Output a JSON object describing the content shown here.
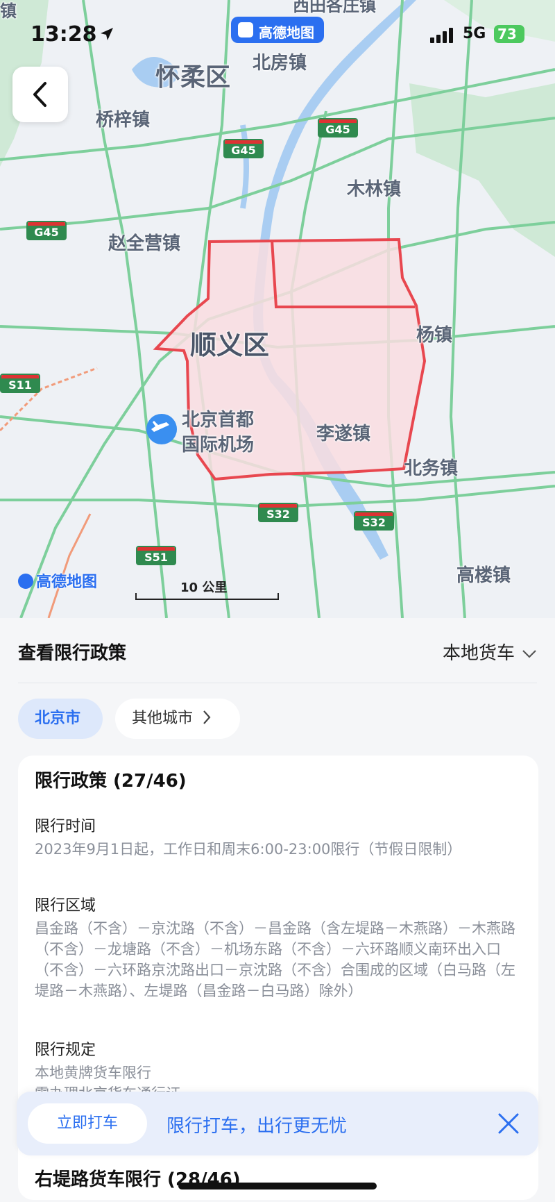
{
  "status_bar": {
    "time": "13:28",
    "network": "5G",
    "battery": "73"
  },
  "brand_pill": {
    "label": "高德地图"
  },
  "map": {
    "labels": {
      "huairou": "怀柔区",
      "beifang": "北房镇",
      "qiaozi": "桥梓镇",
      "mulin": "木林镇",
      "zhaoquanying": "赵全营镇",
      "shunyi": "顺义区",
      "yangzhen": "杨镇",
      "airport_line1": "北京首都",
      "airport_line2": "国际机场",
      "lisui": "李遂镇",
      "beiwu": "北务镇",
      "gaolou": "高楼镇",
      "top_partial": "西田各庄镇",
      "top_left_partial": "镇"
    },
    "shields": {
      "g45_a": "G45",
      "g45_b": "G45",
      "g45_c": "G45",
      "s11": "S11",
      "s32_a": "S32",
      "s32_b": "S32",
      "s51": "S51"
    },
    "logo": "高德地图",
    "scale": "10 公里",
    "colors": {
      "restricted_fill": "#f9dde0",
      "restricted_border": "#e8474f",
      "road": "#7dcf9b",
      "water": "#a9cdf2"
    }
  },
  "panel": {
    "title": "查看限行政策",
    "vehicle_type": "本地货车",
    "city_active": "北京市",
    "city_other": "其他城市",
    "card": {
      "title": "限行政策 (27/46)",
      "time_title": "限行时间",
      "time_body": "2023年9月1日起，工作日和周末6:00-23:00限行（节假日限制）",
      "area_title": "限行区域",
      "area_body": "昌金路（不含）－京沈路（不含）－昌金路（含左堤路－木燕路）－木燕路（不含）－龙塘路（不含）－机场东路（不含）－六环路顺义南环出入口（不含）－六环路京沈路出口－京沈路（不含）合围成的区域（白马路（左堤路－木燕路）、左堤路（昌金路－白马路）除外）",
      "rule_title": "限行规定",
      "rule_line1": "本地黄牌货车限行",
      "rule_line2": "需办理北京货车通行证"
    },
    "banner": {
      "cta": "立即打车",
      "message": "限行打车，出行更无忧"
    },
    "next_card_title": "右堤路货车限行 (28/46)"
  }
}
